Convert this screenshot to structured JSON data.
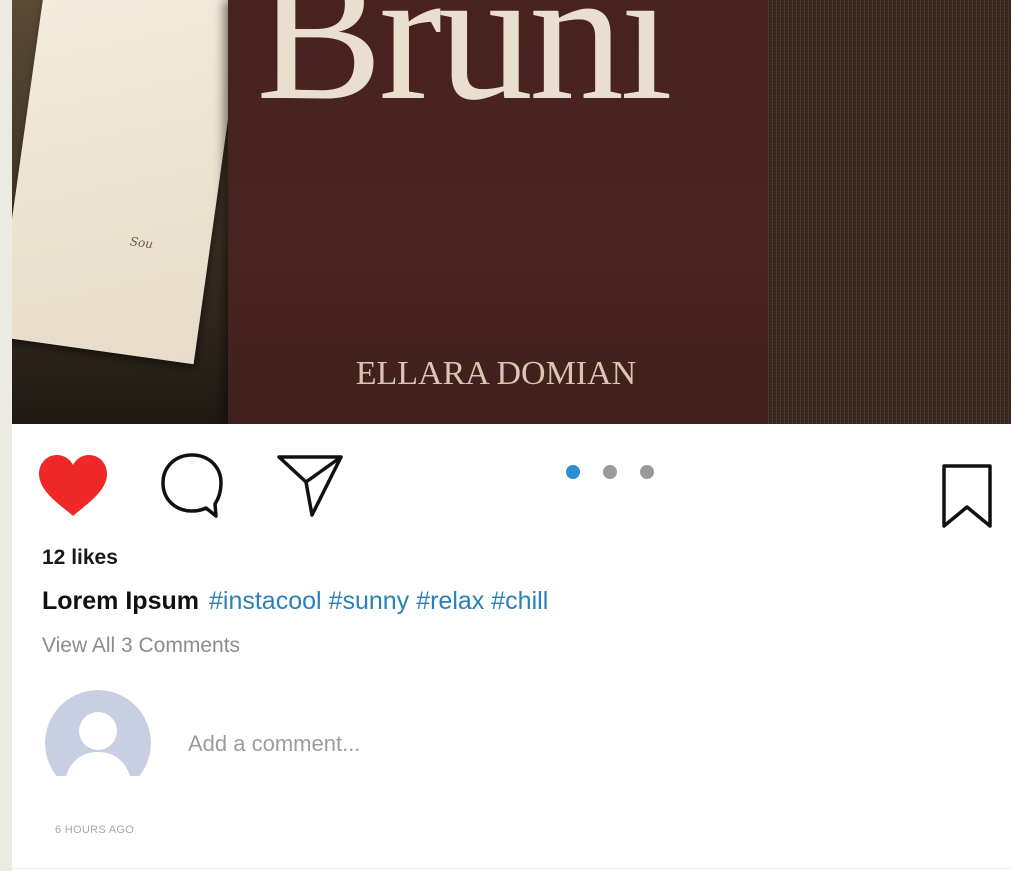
{
  "post": {
    "image": {
      "book_title": "Bruni",
      "book_author": "ELLARA DOMIAN",
      "paper_note": "Sou"
    },
    "actions": {
      "like_icon": "heart-filled-icon",
      "liked": true,
      "like_color": "#ef2727",
      "comment_icon": "speech-bubble-icon",
      "share_icon": "paper-plane-icon",
      "save_icon": "bookmark-icon"
    },
    "carousel": {
      "total": 3,
      "active_index": 0,
      "active_color": "#2f8ed0",
      "inactive_color": "#9a9a9a"
    },
    "likes_text": "12 likes",
    "caption": {
      "username": "Lorem Ipsum",
      "hashtags": [
        "#instacool",
        "#sunny",
        "#relax",
        "#chill"
      ],
      "hashtag_color": "#2a7fb8"
    },
    "view_comments_text": "View All 3 Comments",
    "add_comment": {
      "avatar_icon": "default-user-avatar-icon",
      "placeholder": "Add a comment..."
    },
    "timestamp": "6 HOURS AGO"
  }
}
